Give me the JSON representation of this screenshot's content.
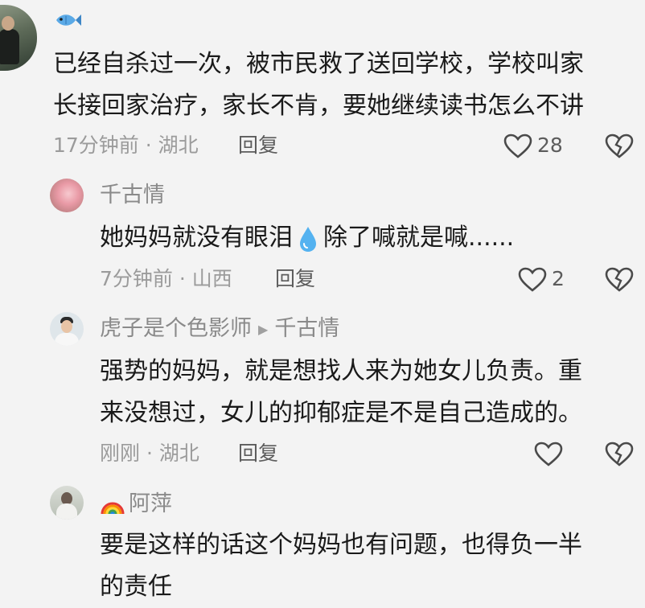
{
  "comments": [
    {
      "username_emoji": "fish",
      "text_lines": [
        "已经自杀过一次，被市民救了送回学校，学校叫家",
        "长接回家治疗，家长不肯，要她继续读书怎么不讲"
      ],
      "time_location": "17分钟前 · 湖北",
      "reply_label": "回复",
      "like_count": "28"
    },
    {
      "username": "千古情",
      "text_before_emoji": "她妈妈就没有眼泪",
      "text_emoji": "droplet",
      "text_after_emoji": "除了喊就是喊......",
      "time_location": "7分钟前 · 山西",
      "reply_label": "回复",
      "like_count": "2"
    },
    {
      "username": "虎子是个色影师",
      "reply_to": "千古情",
      "text_lines": [
        "强势的妈妈，就是想找人来为她女儿负责。重",
        "来没想过，女儿的抑郁症是不是自己造成的。"
      ],
      "time_location": "刚刚 · 湖北",
      "reply_label": "回复",
      "like_count": ""
    },
    {
      "username_emoji": "rainbow",
      "username": "阿萍",
      "text_lines": [
        "要是这样的话这个妈妈也有问题，也得负一半",
        "的责任"
      ]
    }
  ],
  "colors": {
    "background": "#f3f3f3",
    "text": "#1a1a1a",
    "meta": "#9b9b9b",
    "icon": "#4a4a4a"
  },
  "icons": [
    "fish-icon",
    "heart-icon",
    "broken-heart-icon",
    "droplet-icon",
    "rainbow-icon",
    "reply-arrow-icon"
  ]
}
